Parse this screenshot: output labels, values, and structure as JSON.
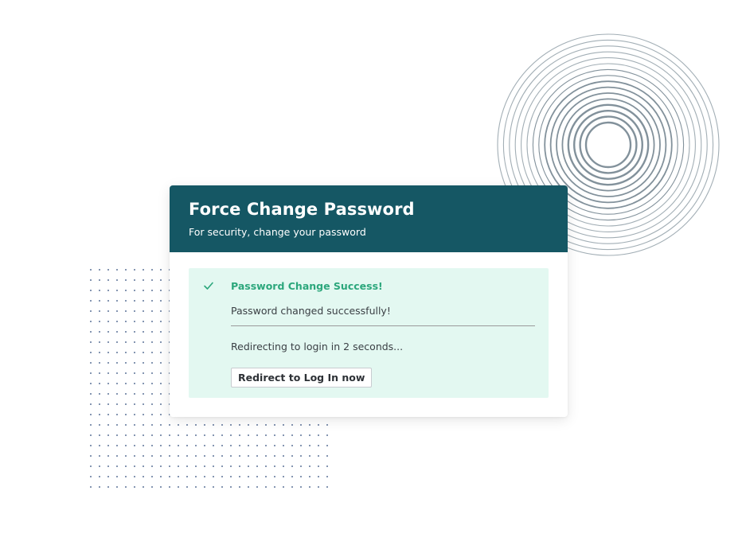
{
  "card": {
    "title": "Force Change Password",
    "subtitle": "For security, change your password"
  },
  "alert": {
    "icon": "check-icon",
    "title": "Password Change Success!",
    "message": "Password changed successfully!",
    "redirect_text": "Redirecting to login in 2 seconds...",
    "button_label": "Redirect to Log In now"
  },
  "colors": {
    "header_bg": "#155764",
    "alert_bg": "#e3f8f1",
    "success_green": "#2ca77c",
    "decoration_ring": "#7b8b96",
    "decoration_dot": "#2d4a7a"
  }
}
